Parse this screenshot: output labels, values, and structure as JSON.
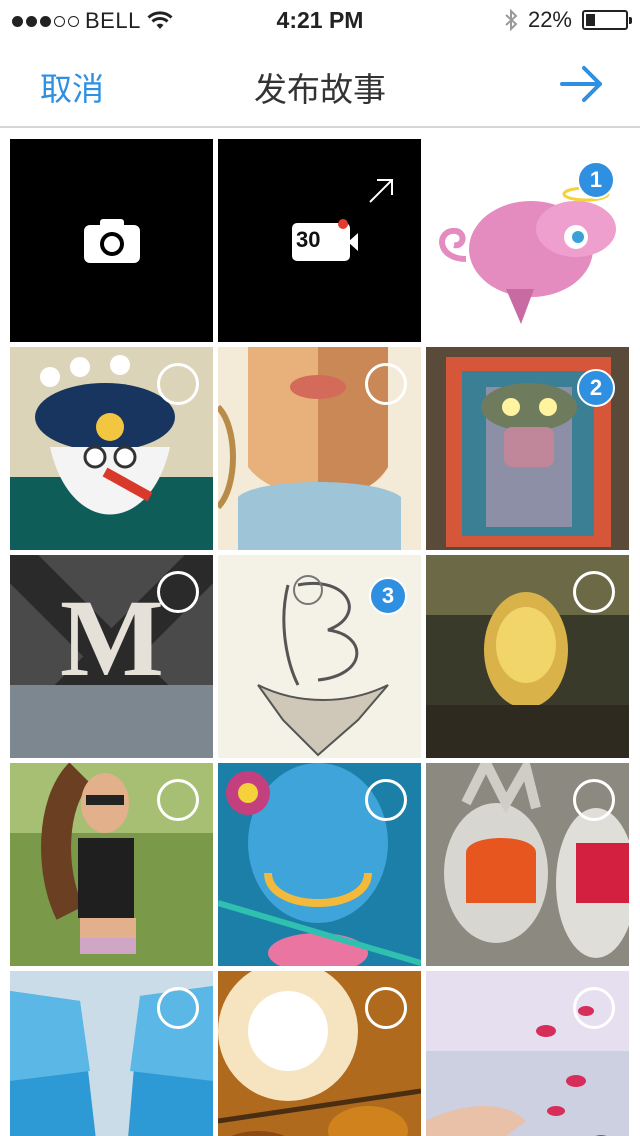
{
  "status_bar": {
    "carrier": "BELL",
    "time": "4:21 PM",
    "battery": "22%",
    "battery_level": 0.22,
    "signal_bars_filled": 3,
    "signal_bars_total": 5
  },
  "nav": {
    "cancel_label": "取消",
    "title": "发布故事",
    "next_icon": "arrow-right-icon",
    "accent_color": "#2f8fe0"
  },
  "grid": {
    "camera_icon": "camera-icon",
    "video_label": "30",
    "video_icon": "video-camera-icon",
    "expand_icon": "expand-arrow-icon",
    "photos": [
      {
        "name": "pink-elephant",
        "selected_index": "1"
      },
      {
        "name": "sailor-captain",
        "selected_index": null
      },
      {
        "name": "girl-portrait",
        "selected_index": null
      },
      {
        "name": "framed-monster",
        "selected_index": "2"
      },
      {
        "name": "letter-m-collage",
        "selected_index": null
      },
      {
        "name": "letter-b-tree-island",
        "selected_index": "3"
      },
      {
        "name": "pixel-mona-lisa",
        "selected_index": null
      },
      {
        "name": "woman-sunglasses",
        "selected_index": null
      },
      {
        "name": "blue-creature",
        "selected_index": null
      },
      {
        "name": "sculpture-faces",
        "selected_index": null
      },
      {
        "name": "ice-cliffs",
        "selected_index": null
      },
      {
        "name": "autumn-leaves-sun",
        "selected_index": null
      },
      {
        "name": "hand-petals",
        "selected_index": null
      }
    ]
  }
}
